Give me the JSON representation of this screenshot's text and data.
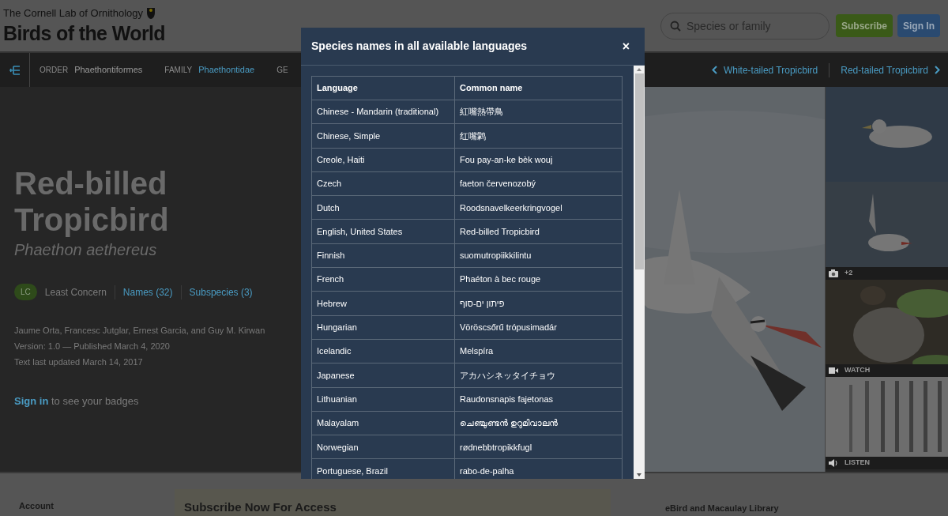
{
  "header": {
    "lab_name": "The Cornell Lab of Ornithology",
    "site_name": "Birds of the World",
    "search": {
      "placeholder": "Species or family"
    },
    "buttons": [
      {
        "label": "Subscribe",
        "kind": "subscribe"
      },
      {
        "label": "Sign In",
        "kind": "signin"
      }
    ]
  },
  "taxonomy_bar": {
    "items": [
      {
        "label": "ORDER",
        "value": "Phaethontiformes",
        "link": false
      },
      {
        "label": "FAMILY",
        "value": "Phaethontidae",
        "link": true
      },
      {
        "label": "GE"
      }
    ],
    "previous": "White-tailed Tropicbird",
    "next": "Red-tailed Tropicbird"
  },
  "species": {
    "name": "Red-billed Tropicbird",
    "scientific_name": "Phaethon aethereus",
    "status_code": "LC",
    "status": "Least Concern",
    "names_link": "Names (32)",
    "subspecies_link": "Subspecies (3)",
    "authors": "Jaume Orta, Francesc Jutglar, Ernest Garcia, and Guy M. Kirwan",
    "version": "Version: 1.0 — Published March 4, 2020",
    "updated": "Text last updated March 14, 2017",
    "signin_link": "Sign in",
    "signin_text": " to see your badges"
  },
  "media": [
    {
      "label": "+2"
    },
    {
      "kind": "video",
      "label": "WATCH"
    },
    {
      "kind": "audio",
      "label": "LISTEN"
    }
  ],
  "footer": {
    "account": "Account",
    "subscribe_heading": "Subscribe Now For Access",
    "ebird": "eBird and Macaulay Library"
  },
  "modal": {
    "title": "Species names in all available languages",
    "close": "×",
    "columns": [
      "Language",
      "Common name"
    ],
    "rows": [
      [
        "Chinese - Mandarin (traditional)",
        "紅嘴熱帶鳥"
      ],
      [
        "Chinese, Simple",
        "红嘴鹲"
      ],
      [
        "Creole, Haiti",
        "Fou pay-an-ke bèk wouj"
      ],
      [
        "Czech",
        "faeton červenozobý"
      ],
      [
        "Dutch",
        "Roodsnavelkeerkringvogel"
      ],
      [
        "English, United States",
        "Red-billed Tropicbird"
      ],
      [
        "Finnish",
        "suomutropiikkilintu"
      ],
      [
        "French",
        "Phaéton à bec rouge"
      ],
      [
        "Hebrew",
        "פיתון ים-סוף"
      ],
      [
        "Hungarian",
        "Vöröscsőrű trópusimadár"
      ],
      [
        "Icelandic",
        "Melspíra"
      ],
      [
        "Japanese",
        "アカハシネッタイチョウ"
      ],
      [
        "Lithuanian",
        "Raudonsnapis fajetonas"
      ],
      [
        "Malayalam",
        "ചെഞ്ചുണ്ടൻ ഉറുമിവാലൻ"
      ],
      [
        "Norwegian",
        "rødnebbtropikkfugl"
      ],
      [
        "Portuguese, Brazil",
        "rabo-de-palha"
      ]
    ]
  }
}
